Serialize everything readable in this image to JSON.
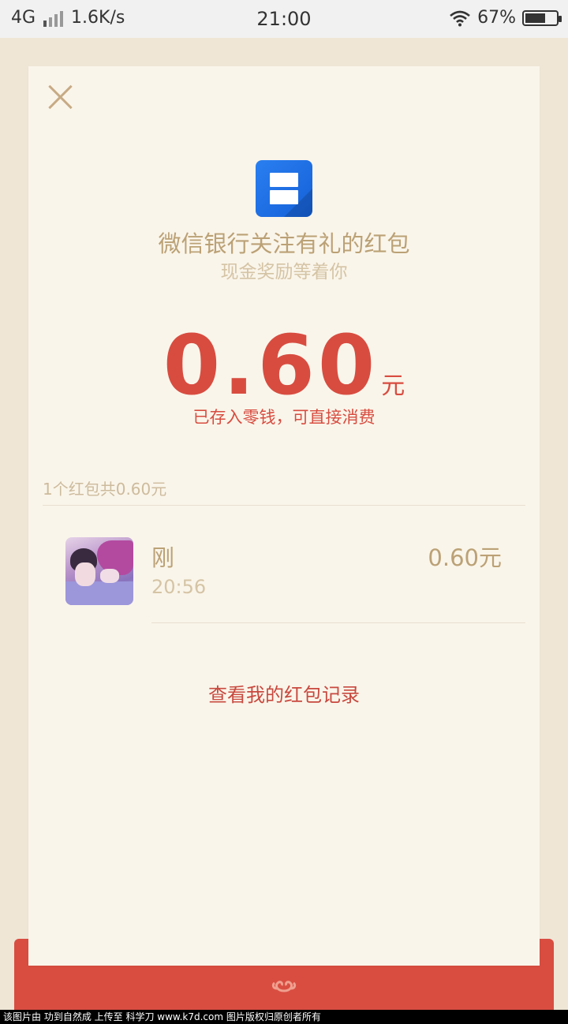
{
  "status_bar": {
    "network": "4G",
    "speed": "1.6K/s",
    "time": "21:00",
    "battery": "67%",
    "battery_level": 0.67
  },
  "card": {
    "title": "微信银行关注有礼的红包",
    "subtitle": "现金奖励等着你",
    "amount": "0.60",
    "amount_unit": "元",
    "deposit_note": "已存入零钱，可直接消费",
    "summary": "1个红包共0.60元",
    "record": {
      "name": "刚",
      "time": "20:56",
      "amount": "0.60元"
    },
    "history_link": "查看我的红包记录"
  },
  "footer": {
    "watermark": "该图片由 功到自然成 上传至 科学刀 www.k7d.com 图片版权归原创者所有"
  },
  "colors": {
    "accent_red": "#d84c40",
    "gold_text": "#bba176",
    "card_bg": "#faf5ea",
    "page_bg": "#efe6d6"
  }
}
